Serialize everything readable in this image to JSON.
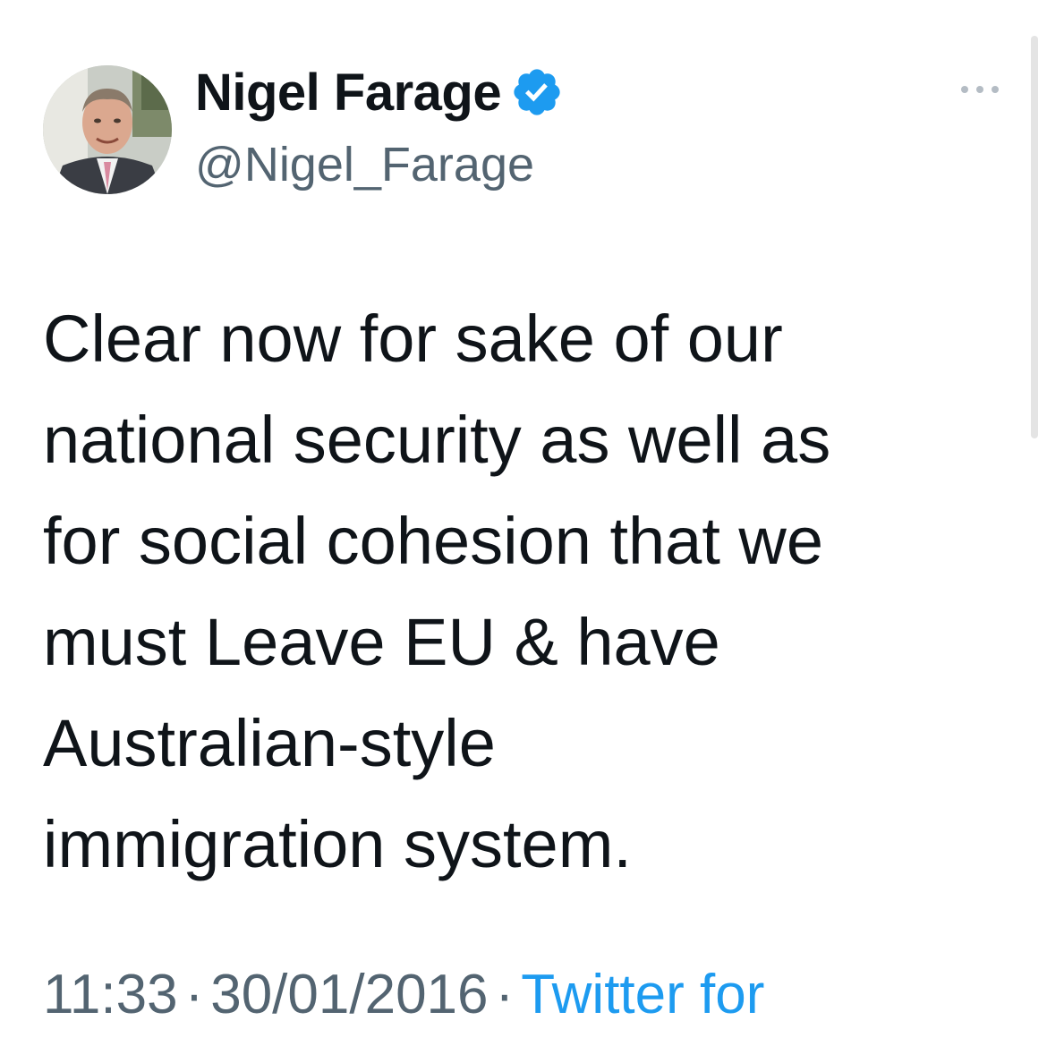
{
  "author": {
    "display_name": "Nigel Farage",
    "handle": "@Nigel_Farage",
    "verified": true,
    "verified_color": "#1d9bf0"
  },
  "tweet": {
    "text": "Clear now for sake of our\nnational security as well as\nfor social cohesion that we\nmust Leave EU & have\nAustralian-style\nimmigration system.",
    "time": "11:33",
    "separator": "·",
    "date": "30/01/2016",
    "source": "Twitter for"
  },
  "icons": {
    "more": "more-icon",
    "verified": "verified-badge-icon",
    "avatar": "avatar"
  },
  "colors": {
    "text_primary": "#0f1419",
    "text_secondary": "#536471",
    "link": "#1d9bf0",
    "background": "#ffffff"
  }
}
